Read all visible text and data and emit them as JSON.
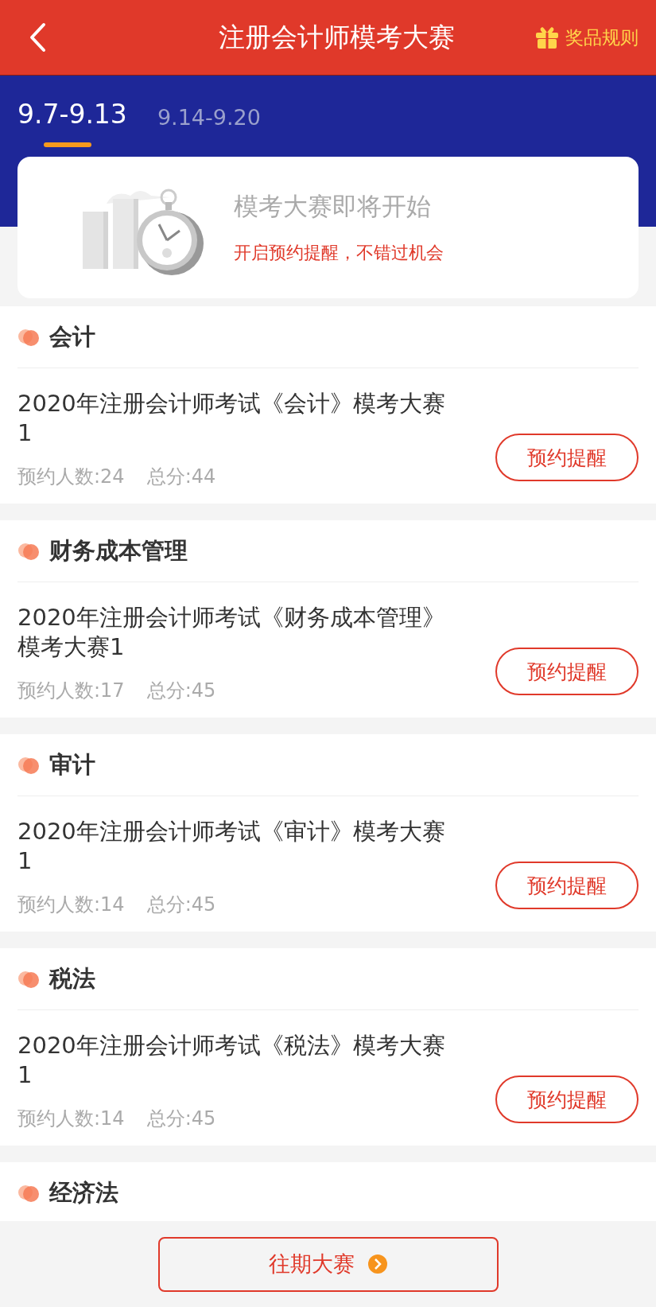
{
  "header": {
    "title": "注册会计师模考大赛",
    "rules_link": "奖品规则"
  },
  "tabs": [
    {
      "label": "9.7-9.13",
      "selected": true
    },
    {
      "label": "9.14-9.20",
      "selected": false
    }
  ],
  "banner": {
    "title": "模考大赛即将开始",
    "subtitle": "开启预约提醒，不错过机会"
  },
  "sections": [
    {
      "name": "会计",
      "items": [
        {
          "title": "2020年注册会计师考试《会计》模考大赛1",
          "signups": "预约人数:24",
          "score": "总分:44",
          "button": "预约提醒"
        }
      ]
    },
    {
      "name": "财务成本管理",
      "items": [
        {
          "title": "2020年注册会计师考试《财务成本管理》模考大赛1",
          "signups": "预约人数:17",
          "score": "总分:45",
          "button": "预约提醒"
        }
      ]
    },
    {
      "name": "审计",
      "items": [
        {
          "title": "2020年注册会计师考试《审计》模考大赛1",
          "signups": "预约人数:14",
          "score": "总分:45",
          "button": "预约提醒"
        }
      ]
    },
    {
      "name": "税法",
      "items": [
        {
          "title": "2020年注册会计师考试《税法》模考大赛1",
          "signups": "预约人数:14",
          "score": "总分:45",
          "button": "预约提醒"
        }
      ]
    },
    {
      "name": "经济法"
    }
  ],
  "footer": {
    "button": "往期大赛"
  }
}
